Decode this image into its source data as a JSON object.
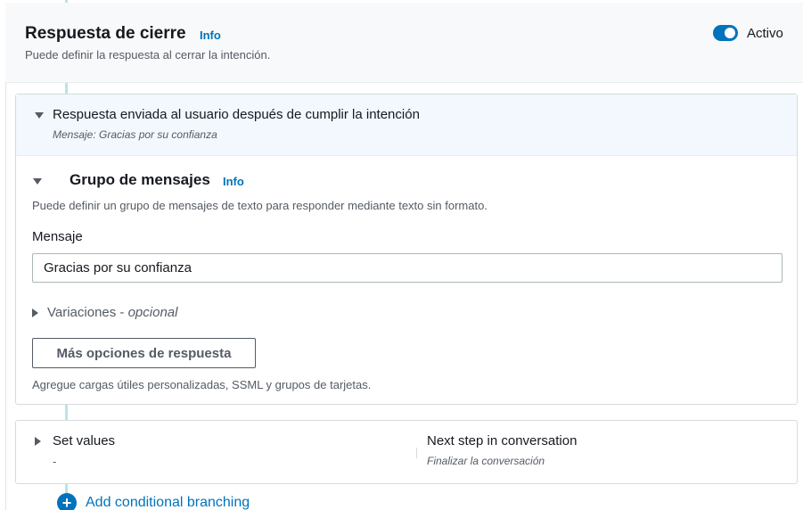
{
  "header": {
    "title": "Respuesta de cierre",
    "info_label": "Info",
    "description": "Puede definir la respuesta al cerrar la intención.",
    "toggle_label": "Activo",
    "toggle_on": true
  },
  "response_section": {
    "title": "Respuesta enviada al usuario después de cumplir la intención",
    "subtitle": "Mensaje: Gracias por su confianza"
  },
  "message_group": {
    "title": "Grupo de mensajes",
    "info_label": "Info",
    "description": "Puede definir un grupo de mensajes de texto para responder mediante texto sin formato.",
    "message_label": "Mensaje",
    "message_value": "Gracias por su confianza",
    "variations_label": "Variaciones - ",
    "variations_optional": "opcional",
    "more_options_button": "Más opciones de respuesta",
    "more_options_help": "Agregue cargas útiles personalizadas, SSML y grupos de tarjetas."
  },
  "set_values": {
    "title": "Set values",
    "value": "-",
    "next_step_title": "Next step in conversation",
    "next_step_value": "Finalizar la conversación"
  },
  "add_branching": {
    "label": "Add conditional branching",
    "icon": "plus-circle-icon"
  },
  "colors": {
    "accent": "#0073bb",
    "connector": "#b8e4ea",
    "header_bg": "#f8f9fa",
    "expanded_bg": "#f2f8fd"
  }
}
